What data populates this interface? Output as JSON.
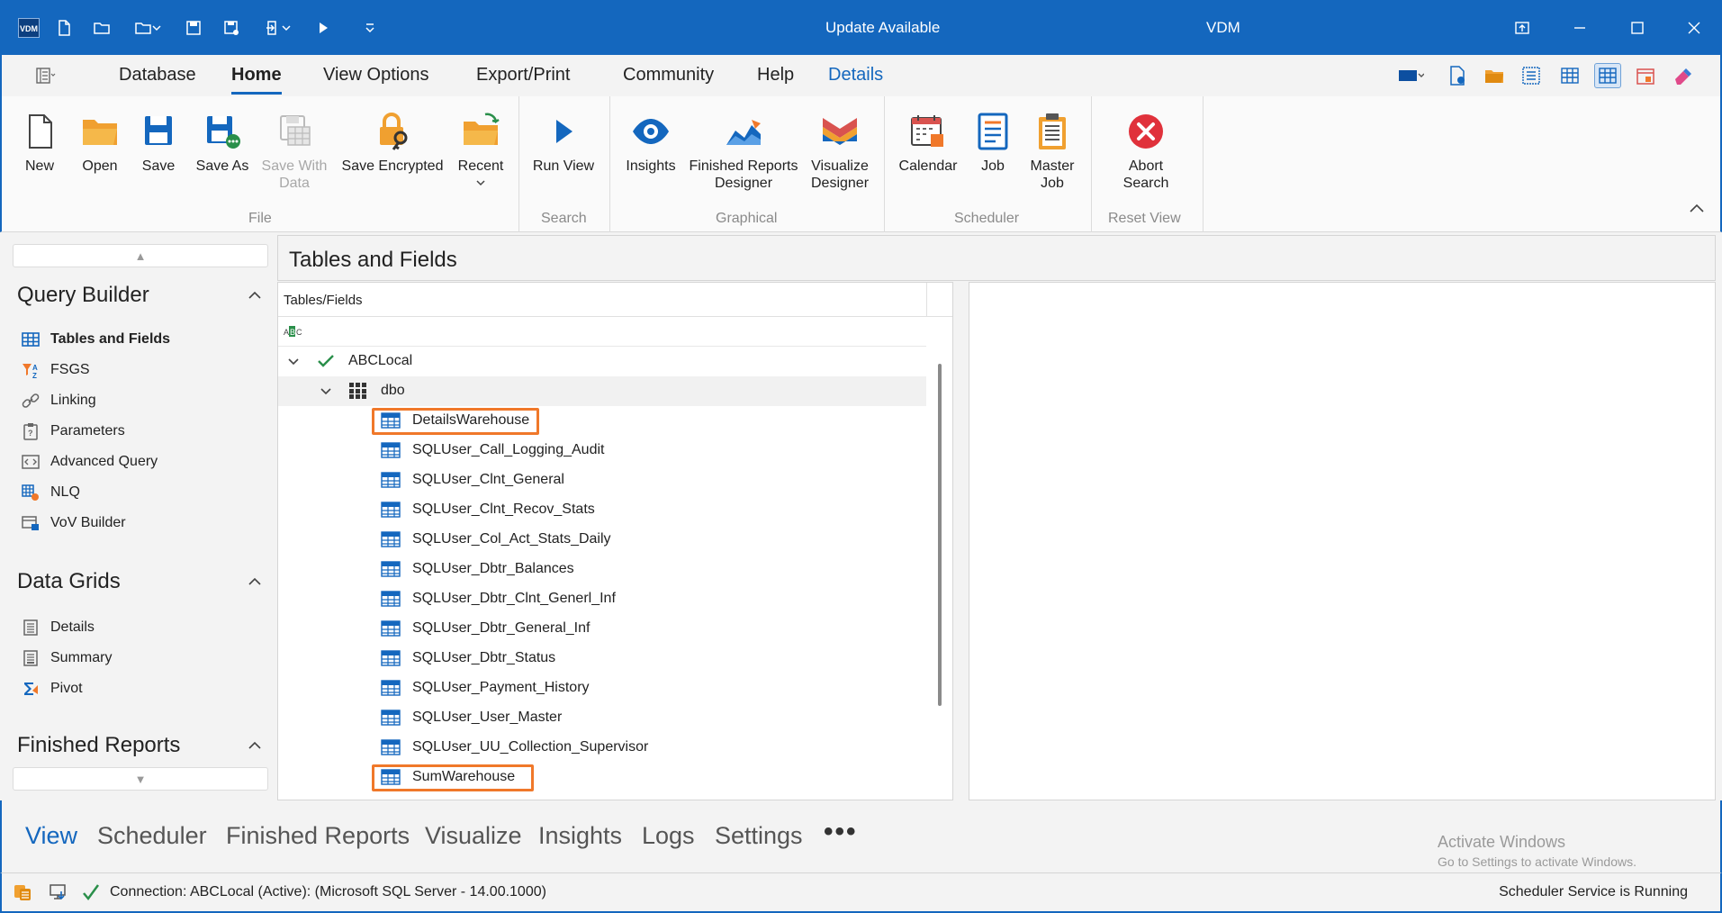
{
  "titlebar": {
    "logo_text": "VDM",
    "center_title": "Update Available",
    "app_title": "VDM"
  },
  "menu": {
    "tabs": [
      {
        "label": "Database"
      },
      {
        "label": "Home"
      },
      {
        "label": "View Options"
      },
      {
        "label": "Export/Print"
      },
      {
        "label": "Community"
      },
      {
        "label": "Help"
      },
      {
        "label": "Details"
      }
    ]
  },
  "ribbon": {
    "file": {
      "group_label": "File",
      "new": "New",
      "open": "Open",
      "save": "Save",
      "save_as": "Save As",
      "save_with_data": "Save With Data",
      "save_encrypted": "Save Encrypted",
      "recent": "Recent"
    },
    "search": {
      "group_label": "Search",
      "run_view": "Run View"
    },
    "graphical": {
      "group_label": "Graphical",
      "insights": "Insights",
      "finished_reports_designer": "Finished Reports Designer",
      "visualize_designer": "Visualize Designer"
    },
    "scheduler": {
      "group_label": "Scheduler",
      "calendar": "Calendar",
      "job": "Job",
      "master_job": "Master Job"
    },
    "reset_view": {
      "group_label": "Reset View",
      "abort_search": "Abort Search"
    }
  },
  "left_panel": {
    "query_builder": {
      "title": "Query Builder",
      "items": [
        "Tables and Fields",
        "FSGS",
        "Linking",
        "Parameters",
        "Advanced Query",
        "NLQ",
        "VoV Builder"
      ]
    },
    "data_grids": {
      "title": "Data Grids",
      "items": [
        "Details",
        "Summary",
        "Pivot"
      ]
    },
    "finished_reports": {
      "title": "Finished Reports"
    }
  },
  "main": {
    "title": "Tables and Fields",
    "column_header": "Tables/Fields",
    "tree": {
      "database": "ABCLocal",
      "schema": "dbo",
      "tables": [
        "DetailsWarehouse",
        "SQLUser_Call_Logging_Audit",
        "SQLUser_Clnt_General",
        "SQLUser_Clnt_Recov_Stats",
        "SQLUser_Col_Act_Stats_Daily",
        "SQLUser_Dbtr_Balances",
        "SQLUser_Dbtr_Clnt_Generl_Inf",
        "SQLUser_Dbtr_General_Inf",
        "SQLUser_Dbtr_Status",
        "SQLUser_Payment_History",
        "SQLUser_User_Master",
        "SQLUser_UU_Collection_Supervisor",
        "SumWarehouse"
      ]
    }
  },
  "bottom_nav": {
    "items": [
      "View",
      "Scheduler",
      "Finished Reports",
      "Visualize",
      "Insights",
      "Logs",
      "Settings"
    ],
    "more": "•••"
  },
  "watermark": {
    "line1": "Activate Windows",
    "line2": "Go to Settings to activate Windows."
  },
  "status": {
    "connection": "Connection: ABCLocal (Active): (Microsoft SQL Server - 14.00.1000)",
    "scheduler": "Scheduler Service is Running"
  },
  "colors": {
    "accent": "#1467be",
    "highlight": "#f0782a"
  }
}
